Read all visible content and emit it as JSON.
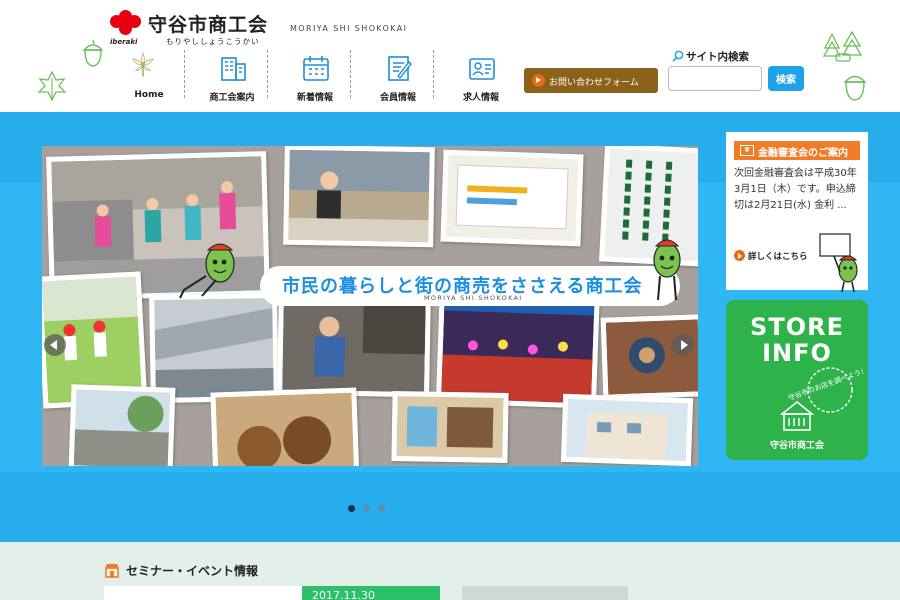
{
  "header": {
    "logo_sub": "iberaki",
    "logo_title": "守谷市商工会",
    "logo_kana": "もりやししょうこうかい",
    "tagline_en": "MORIYA SHI SHOKOKAI"
  },
  "nav": {
    "items": [
      {
        "label": "Home",
        "icon": "lily-flower-icon"
      },
      {
        "label": "商工会案内",
        "icon": "building-icon"
      },
      {
        "label": "新着情報",
        "icon": "calendar-icon"
      },
      {
        "label": "会員情報",
        "icon": "memo-pencil-icon"
      },
      {
        "label": "求人情報",
        "icon": "id-card-icon"
      }
    ]
  },
  "contact": {
    "label": "お問い合わせフォーム"
  },
  "search": {
    "label": "サイト内検索",
    "placeholder": "",
    "value": "",
    "button": "検索"
  },
  "hero": {
    "banner_text": "市民の暮らしと街の商売をささえる商工会",
    "banner_sub": "MORIYA SHI SHOKOKAI",
    "slides": 3,
    "active_slide": 1
  },
  "finance": {
    "badge": "金融審査会のご案内",
    "body": "次回金融審査会は平成30年3月1日（木）です。申込締切は2月21日(水) 金利 ...",
    "more": "詳しくはこちら"
  },
  "store": {
    "title_line1": "STORE",
    "title_line2": "INFO",
    "bubble": "守谷市のお店を調べよう！",
    "footer": "守谷市商工会"
  },
  "seminar": {
    "title": "セミナー・イベント情報",
    "date": "2017.11.30"
  },
  "colors": {
    "hero_blue": "#27adec",
    "banner_text_blue": "#1b8fe0",
    "contact_brown": "#8b6219",
    "search_blue": "#1fa2e8",
    "accent_orange": "#f07c28",
    "store_green": "#2db34a",
    "date_green": "#2dc06a",
    "section_bg": "#e3f0ea"
  }
}
